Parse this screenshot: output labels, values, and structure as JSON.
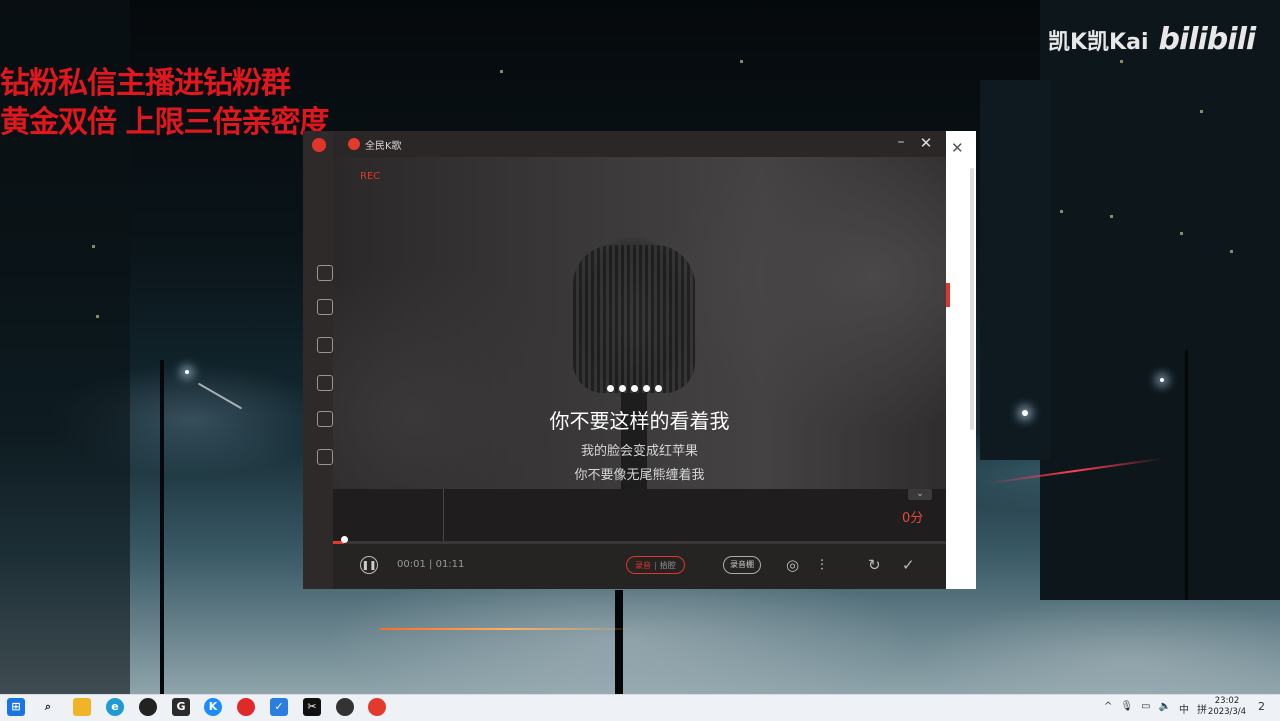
{
  "overlay": {
    "promo_line1": "钻粉私信主播进钻粉群",
    "promo_line2": "黄金双倍 上限三倍亲密度",
    "streamer": "凯K凯Kai",
    "platform": "bilibili"
  },
  "app": {
    "title": "全民K歌",
    "rec_label": "REC",
    "lyrics": {
      "current": "你不要这样的看着我",
      "next1": "我的脸会变成红苹果",
      "next2": "你不要像无尾熊缠着我"
    },
    "score": "0分",
    "time_current": "00:01",
    "time_total": "01:11",
    "time_separator": "|",
    "progress_fraction": 0.018,
    "mode_record": "录音",
    "mode_sing": "拾腔",
    "soundcard_label": "录音棚",
    "accent_color": "#e23b2e"
  },
  "taskbar": {
    "icons": [
      "windows-start-icon",
      "search-icon",
      "file-explorer-icon",
      "edge-browser-icon",
      "qq-penguin-icon",
      "app-g-icon",
      "kugou-music-icon",
      "netease-music-icon",
      "app-check-icon",
      "capcut-icon",
      "app-ball-icon",
      "quanmin-kge-icon"
    ],
    "tray_lang": "中",
    "tray_ime": "拼",
    "time": "23:02",
    "date": "2023/3/4",
    "notifications": "2"
  }
}
